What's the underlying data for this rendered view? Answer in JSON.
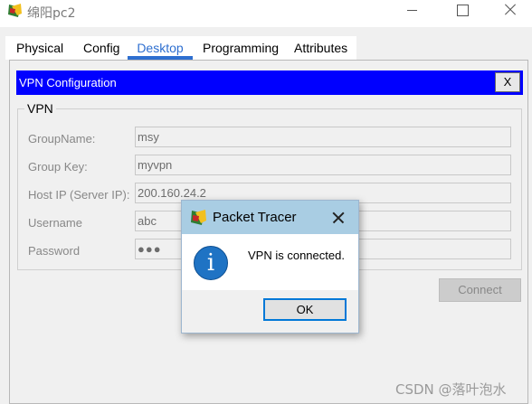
{
  "window": {
    "title": "绵阳pc2",
    "icon": "packet-tracer-pc-icon"
  },
  "tabs": [
    {
      "label": "Physical",
      "active": false
    },
    {
      "label": "Config",
      "active": false
    },
    {
      "label": "Desktop",
      "active": true
    },
    {
      "label": "Programming",
      "active": false
    },
    {
      "label": "Attributes",
      "active": false
    }
  ],
  "vpn_panel": {
    "header_title": "VPN Configuration",
    "close_label": "X",
    "group_title": "VPN",
    "fields": [
      {
        "label": "GroupName:",
        "value": "msy"
      },
      {
        "label": "Group Key:",
        "value": "myvpn"
      },
      {
        "label": "Host IP (Server IP):",
        "value": "200.160.24.2"
      },
      {
        "label": "Username",
        "value": "abc"
      },
      {
        "label": "Password",
        "value": "●●●"
      }
    ],
    "connect_label": "Connect"
  },
  "dialog": {
    "title": "Packet Tracer",
    "message": "VPN is connected.",
    "ok_label": "OK",
    "icon": "info-icon"
  },
  "watermark": "CSDN @落叶泡水",
  "colors": {
    "vpn_header": "#0000ff",
    "active_tab": "#2e6fd0",
    "dialog_titlebar": "#a9cde3",
    "info_icon": "#1f73c4"
  }
}
